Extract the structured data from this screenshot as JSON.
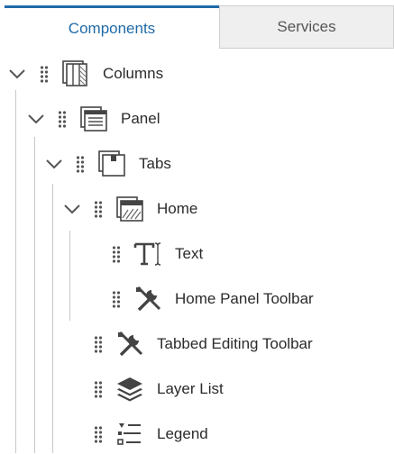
{
  "tabs": [
    {
      "label": "Components",
      "active": true
    },
    {
      "label": "Services",
      "active": false
    }
  ],
  "colors": {
    "accent": "#1f6aa8",
    "text": "#2b2b2b",
    "guide": "#c8c8c8"
  },
  "tree": [
    {
      "label": "Columns",
      "icon": "columns-icon",
      "expanded": true
    },
    {
      "label": "Panel",
      "icon": "panel-icon",
      "expanded": true
    },
    {
      "label": "Tabs",
      "icon": "tabs-icon",
      "expanded": true
    },
    {
      "label": "Home",
      "icon": "home-tab-icon",
      "expanded": true
    },
    {
      "label": "Text",
      "icon": "text-icon"
    },
    {
      "label": "Home Panel Toolbar",
      "icon": "tools-icon"
    },
    {
      "label": "Tabbed Editing Toolbar",
      "icon": "tools-icon"
    },
    {
      "label": "Layer List",
      "icon": "layers-icon"
    },
    {
      "label": "Legend",
      "icon": "legend-icon"
    }
  ]
}
